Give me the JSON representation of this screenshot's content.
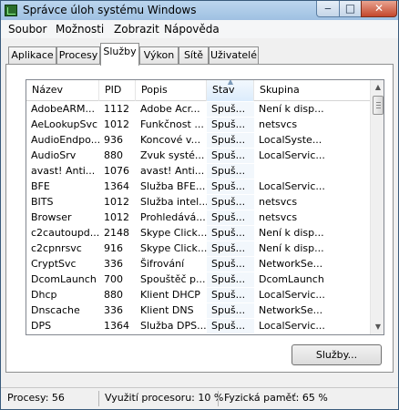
{
  "window": {
    "title": "Správce úloh systému Windows"
  },
  "title_buttons": {
    "minimize": "‒",
    "maximize": "□",
    "close": "✕"
  },
  "menu": [
    {
      "label": "Soubor"
    },
    {
      "label": "Možnosti"
    },
    {
      "label": "Zobrazit"
    },
    {
      "label": "Nápověda"
    }
  ],
  "tabs": [
    {
      "label": "Aplikace",
      "active": false
    },
    {
      "label": "Procesy",
      "active": false
    },
    {
      "label": "Služby",
      "active": true
    },
    {
      "label": "Výkon",
      "active": false
    },
    {
      "label": "Sítě",
      "active": false
    },
    {
      "label": "Uživatelé",
      "active": false
    }
  ],
  "services": {
    "columns": [
      "Název",
      "PID",
      "Popis",
      "Stav",
      "Skupina"
    ],
    "sorted_column": "Stav",
    "rows": [
      [
        "AdobeARM...",
        "1112",
        "Adobe Acr...",
        "Spuš...",
        "Není k disp..."
      ],
      [
        "AeLookupSvc",
        "1012",
        "Funkčnost ...",
        "Spuš...",
        "netsvcs"
      ],
      [
        "AudioEndpo...",
        "936",
        "Koncové v...",
        "Spuš...",
        "LocalSyste..."
      ],
      [
        "AudioSrv",
        "880",
        "Zvuk systé...",
        "Spuš...",
        "LocalServic..."
      ],
      [
        "avast! Anti...",
        "1076",
        "avast! Anti...",
        "Spuš...",
        ""
      ],
      [
        "BFE",
        "1364",
        "Služba BFE...",
        "Spuš...",
        "LocalServic..."
      ],
      [
        "BITS",
        "1012",
        "Služba intel...",
        "Spuš...",
        "netsvcs"
      ],
      [
        "Browser",
        "1012",
        "Prohledává...",
        "Spuš...",
        "netsvcs"
      ],
      [
        "c2cautoupd...",
        "2148",
        "Skype Click...",
        "Spuš...",
        "Není k disp..."
      ],
      [
        "c2cpnrsvc",
        "916",
        "Skype Click...",
        "Spuš...",
        "Není k disp..."
      ],
      [
        "CryptSvc",
        "336",
        "Šifrování",
        "Spuš...",
        "NetworkSe..."
      ],
      [
        "DcomLaunch",
        "700",
        "Spouštěč p...",
        "Spuš...",
        "DcomLaunch"
      ],
      [
        "Dhcp",
        "880",
        "Klient DHCP",
        "Spuš...",
        "LocalServic..."
      ],
      [
        "Dnscache",
        "336",
        "Klient DNS",
        "Spuš...",
        "NetworkSe..."
      ],
      [
        "DPS",
        "1364",
        "Služba DPS...",
        "Spuš...",
        "LocalServic..."
      ]
    ],
    "button_label": "Služby..."
  },
  "status": {
    "processes": "Procesy: 56",
    "cpu": "Využití procesoru: 10 %",
    "memory": "Fyzická paměť: 65 %"
  }
}
